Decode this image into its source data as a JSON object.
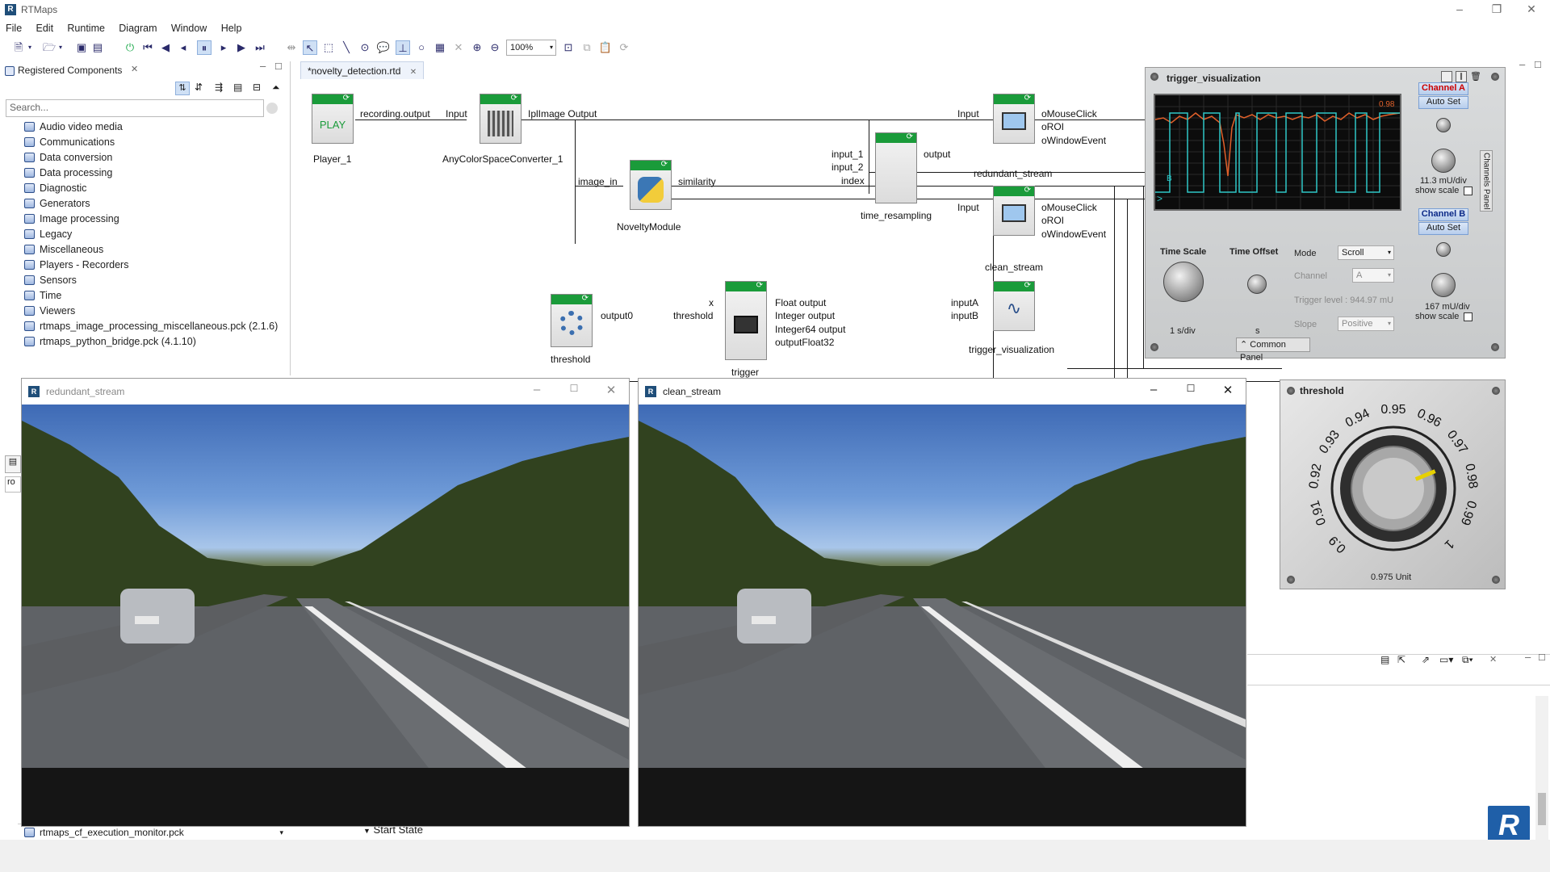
{
  "window": {
    "title": "RTMaps"
  },
  "menu": [
    "File",
    "Edit",
    "Runtime",
    "Diagram",
    "Window",
    "Help"
  ],
  "toolbar": {
    "zoom": "100%"
  },
  "left_panel": {
    "title": "Registered Components",
    "search_placeholder": "Search...",
    "items": [
      "Audio video media",
      "Communications",
      "Data conversion",
      "Data processing",
      "Diagnostic",
      "Generators",
      "Image processing",
      "Legacy",
      "Miscellaneous",
      "Players - Recorders",
      "Sensors",
      "Time",
      "Viewers",
      "rtmaps_image_processing_miscellaneous.pck (2.1.6)",
      "rtmaps_python_bridge.pck (4.1.10)"
    ],
    "bottom_item": "rtmaps_cf_execution_monitor.pck",
    "side_input": "ro"
  },
  "editor": {
    "tab": "*novelty_detection.rtd",
    "components": {
      "player": {
        "label": "Player_1",
        "face": "PLAY",
        "output": "recording.output"
      },
      "converter": {
        "label": "AnyColorSpaceConverter_1",
        "input": "Input",
        "output": "IplImage Output"
      },
      "novelty": {
        "label": "NoveltyModule",
        "input": "image_in",
        "output": "similarity"
      },
      "resampling": {
        "label": "time_resampling",
        "inputs": [
          "input_1",
          "input_2",
          "index"
        ],
        "output": "output"
      },
      "redundant": {
        "label": "redundant_stream",
        "input": "Input",
        "outputs": [
          "oMouseClick",
          "oROI",
          "oWindowEvent"
        ]
      },
      "clean": {
        "label": "clean_stream",
        "input": "Input",
        "outputs": [
          "oMouseClick",
          "oROI",
          "oWindowEvent"
        ]
      },
      "threshold": {
        "label": "threshold",
        "output": "output0"
      },
      "trigger": {
        "label": "trigger",
        "inputs": [
          "x",
          "threshold"
        ],
        "outputs": [
          "Float output",
          "Integer output",
          "Integer64 output",
          "outputFloat32"
        ]
      },
      "trigger_vis": {
        "label": "trigger_visualization",
        "inputs": [
          "inputA",
          "inputB"
        ]
      }
    }
  },
  "scope": {
    "title": "trigger_visualization",
    "screen_value": "0.98",
    "marker": "B",
    "channel_a": {
      "label": "Channel A",
      "auto": "Auto Set",
      "scale": "11.3 mU/div",
      "show": "show scale"
    },
    "channel_b": {
      "label": "Channel B",
      "auto": "Auto Set",
      "scale": "167 mU/div",
      "show": "show scale"
    },
    "channels_panel": "Channels Panel",
    "time_scale": {
      "label": "Time Scale",
      "value": "1 s/div"
    },
    "time_offset": {
      "label": "Time Offset",
      "value": "s"
    },
    "mode": {
      "label": "Mode",
      "value": "Scroll"
    },
    "channel": {
      "label": "Channel",
      "value": "A"
    },
    "trigger_level": "Trigger level : 944.97 mU",
    "slope": {
      "label": "Slope",
      "value": "Positive"
    },
    "common_panel": "Common Panel"
  },
  "threshold_widget": {
    "title": "threshold",
    "ticks": [
      "0.9",
      "0.91",
      "0.92",
      "0.93",
      "0.94",
      "0.95",
      "0.96",
      "0.97",
      "0.98",
      "0.99",
      "1"
    ],
    "value_label": "0.975  Unit",
    "value": 0.975
  },
  "video_windows": [
    {
      "title": "redundant_stream"
    },
    {
      "title": "clean_stream"
    }
  ],
  "bottom": {
    "start_state": "Start State"
  }
}
